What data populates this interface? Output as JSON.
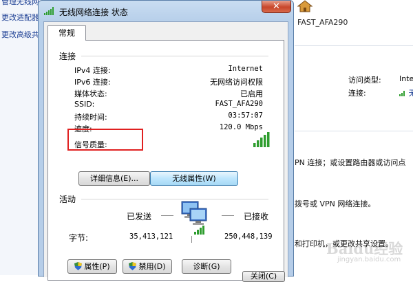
{
  "background": {
    "sidebar_links": [
      "管理无线网",
      "更改适配器",
      "更改高级共"
    ],
    "ssid": "FAST_AFA290",
    "access_type_label": "访问类型:",
    "access_type_value": "Inte",
    "connection_label": "连接:",
    "connection_value": "无线",
    "text_lines": [
      "PN 连接；或设置路由器或访问点",
      "拨号或 VPN 网络连接。",
      "和打印机，或更改共享设置。"
    ],
    "watermark": "Baidu经验",
    "watermark_sub": "jingyan.baidu.com"
  },
  "window": {
    "title": "无线网络连接 状态",
    "close_symbol": "✕",
    "tab": "常规",
    "connection_section": "连接",
    "rows": [
      {
        "label": "IPv4 连接:",
        "value": "Internet"
      },
      {
        "label": "IPv6 连接:",
        "value": "无网络访问权限"
      },
      {
        "label": "媒体状态:",
        "value": "已启用"
      },
      {
        "label": "SSID:",
        "value": "FAST_AFA290"
      },
      {
        "label": "持续时间:",
        "value": "03:57:07"
      },
      {
        "label": "速度:",
        "value": "120.0 Mbps"
      }
    ],
    "signal_label": "信号质量:",
    "signal_bars_filled": 5,
    "signal_bars_total": 5,
    "details_button": "详细信息(E)...",
    "wireless_props_button": "无线属性(W)",
    "activity_section": "活动",
    "sent_label": "已发送",
    "received_label": "已接收",
    "bytes_label": "字节:",
    "bytes_sent": "35,413,121",
    "bytes_received": "250,448,139",
    "properties_button": "属性(P)",
    "disable_button": "禁用(D)",
    "diagnose_button": "诊断(G)",
    "close_button": "关闭(C)"
  },
  "colors": {
    "highlight_box": "#e02020",
    "signal_green": "#2e9d2e",
    "titlebar": "#c9ddf1"
  }
}
